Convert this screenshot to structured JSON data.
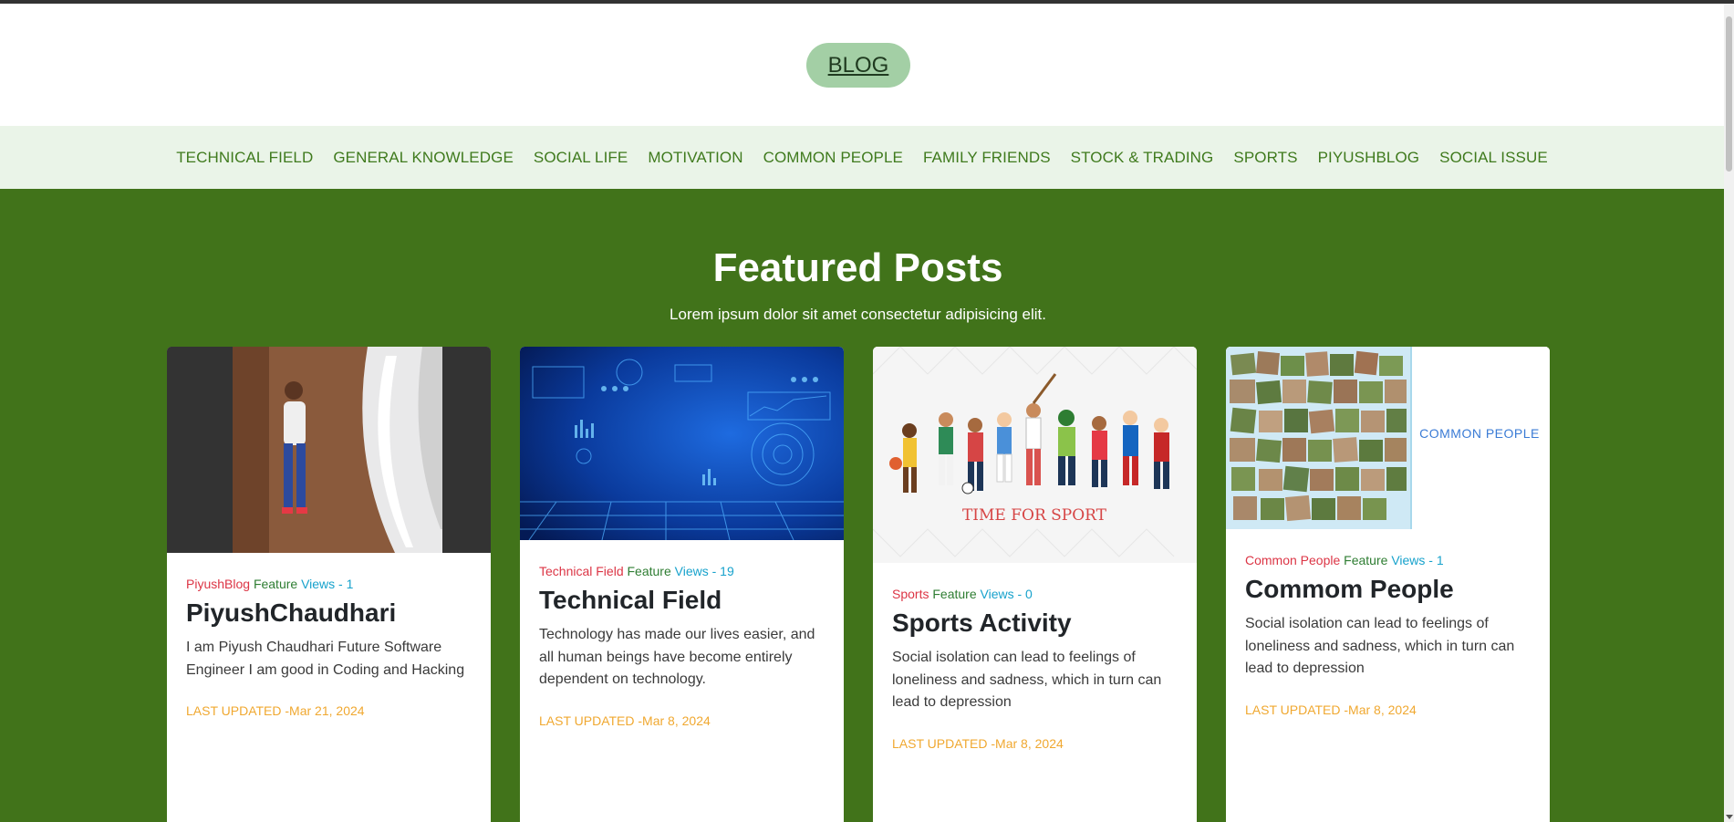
{
  "header": {
    "logo_label": "BLOG"
  },
  "nav": {
    "items": [
      "TECHNICAL FIELD",
      "GENERAL KNOWLEDGE",
      "SOCIAL LIFE",
      "MOTIVATION",
      "COMMON PEOPLE",
      "FAMILY FRIENDS",
      "STOCK & TRADING",
      "SPORTS",
      "PIYUSHBLOG",
      "SOCIAL ISSUE"
    ]
  },
  "featured": {
    "title": "Featured Posts",
    "subtitle": "Lorem ipsum dolor sit amet consectetur adipisicing elit.",
    "posts": [
      {
        "category": "PiyushBlog",
        "feature": "Feature",
        "views": "Views - 1",
        "title": "PiyushChaudhari",
        "description": "I am Piyush Chaudhari Future Software Engineer I am good in Coding and Hacking",
        "updated": "LAST UPDATED -Mar 21, 2024"
      },
      {
        "category": "Technical Field",
        "feature": "Feature",
        "views": "Views - 19",
        "title": "Technical Field",
        "description": "Technology has made our lives easier, and all human beings have become entirely dependent on technology.",
        "updated": "LAST UPDATED -Mar 8, 2024"
      },
      {
        "category": "Sports",
        "feature": "Feature",
        "views": "Views - 0",
        "title": "Sports Activity",
        "description": "Social isolation can lead to feelings of loneliness and sadness, which in turn can lead to depression",
        "updated": "LAST UPDATED -Mar 8, 2024",
        "image_caption": "TIME FOR SPORT"
      },
      {
        "category": "Common People",
        "feature": "Feature",
        "views": "Views - 1",
        "title": "Commom People",
        "description": "Social isolation can lead to feelings of loneliness and sadness, which in turn can lead to depression",
        "updated": "LAST UPDATED -Mar 8, 2024",
        "image_caption": "COMMON PEOPLE"
      }
    ]
  },
  "colors": {
    "featured_bg": "#41731a",
    "nav_bg": "#eaf4e8",
    "nav_text": "#3f7a1d",
    "logo_bg": "#a3cfa5",
    "category": "#dc3545",
    "feature": "#2e7d32",
    "views": "#17a2cc",
    "updated": "#f0a830"
  }
}
